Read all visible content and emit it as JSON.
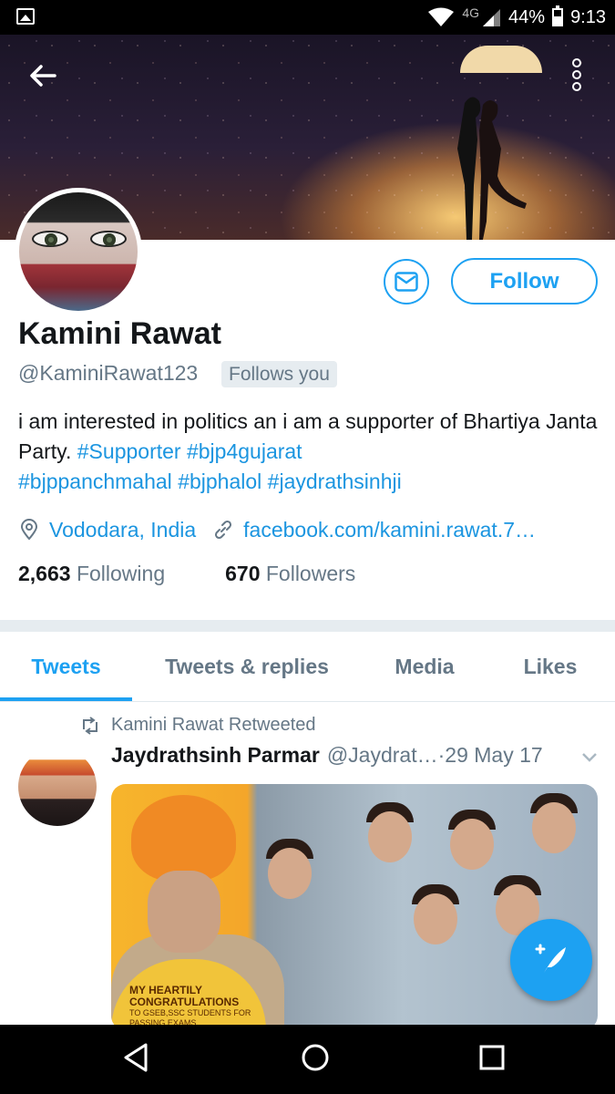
{
  "status_bar": {
    "network": "4G",
    "battery": "44%",
    "time": "9:13",
    "icons": [
      "image-icon",
      "wifi-icon",
      "signal-icon",
      "battery-icon"
    ]
  },
  "header": {
    "back_icon": "arrow-left-icon",
    "more_icon": "more-vertical-icon"
  },
  "profile": {
    "name": "Kamini Rawat",
    "handle": "@KaminiRawat123",
    "follows_you": "Follows you",
    "follow_label": "Follow",
    "message_icon": "mail-icon",
    "bio_text": "i am interested in politics an i am a supporter of Bhartiya Janta Party. ",
    "bio_tags": [
      "#Supporter",
      "#bjp4gujarat",
      "#bjppanchmahal",
      "#bjphalol",
      "#jaydrathsinhji"
    ],
    "location": "Vododara, India",
    "website": "facebook.com/kamini.rawat.7…",
    "following_count": "2,663",
    "following_label": "Following",
    "followers_count": "670",
    "followers_label": "Followers"
  },
  "tabs": [
    {
      "label": "Tweets",
      "active": true
    },
    {
      "label": "Tweets & replies",
      "active": false
    },
    {
      "label": "Media",
      "active": false
    },
    {
      "label": "Likes",
      "active": false
    }
  ],
  "tweet": {
    "retweet_label": "Kamini Rawat Retweeted",
    "author": "Jaydrathsinh Parmar",
    "handle": "@Jaydrat…",
    "separator": " · ",
    "date": "29 May 17",
    "media_text_1": "MY HEARTILY",
    "media_text_2": "CONGRATULATIONS",
    "media_text_3": "TO GSEB,SSC STUDENTS FOR",
    "media_text_4": "PASSING EXAMS"
  },
  "colors": {
    "accent": "#1da1f2",
    "link": "#1b95e0",
    "text": "#14171a",
    "secondary": "#657786"
  }
}
